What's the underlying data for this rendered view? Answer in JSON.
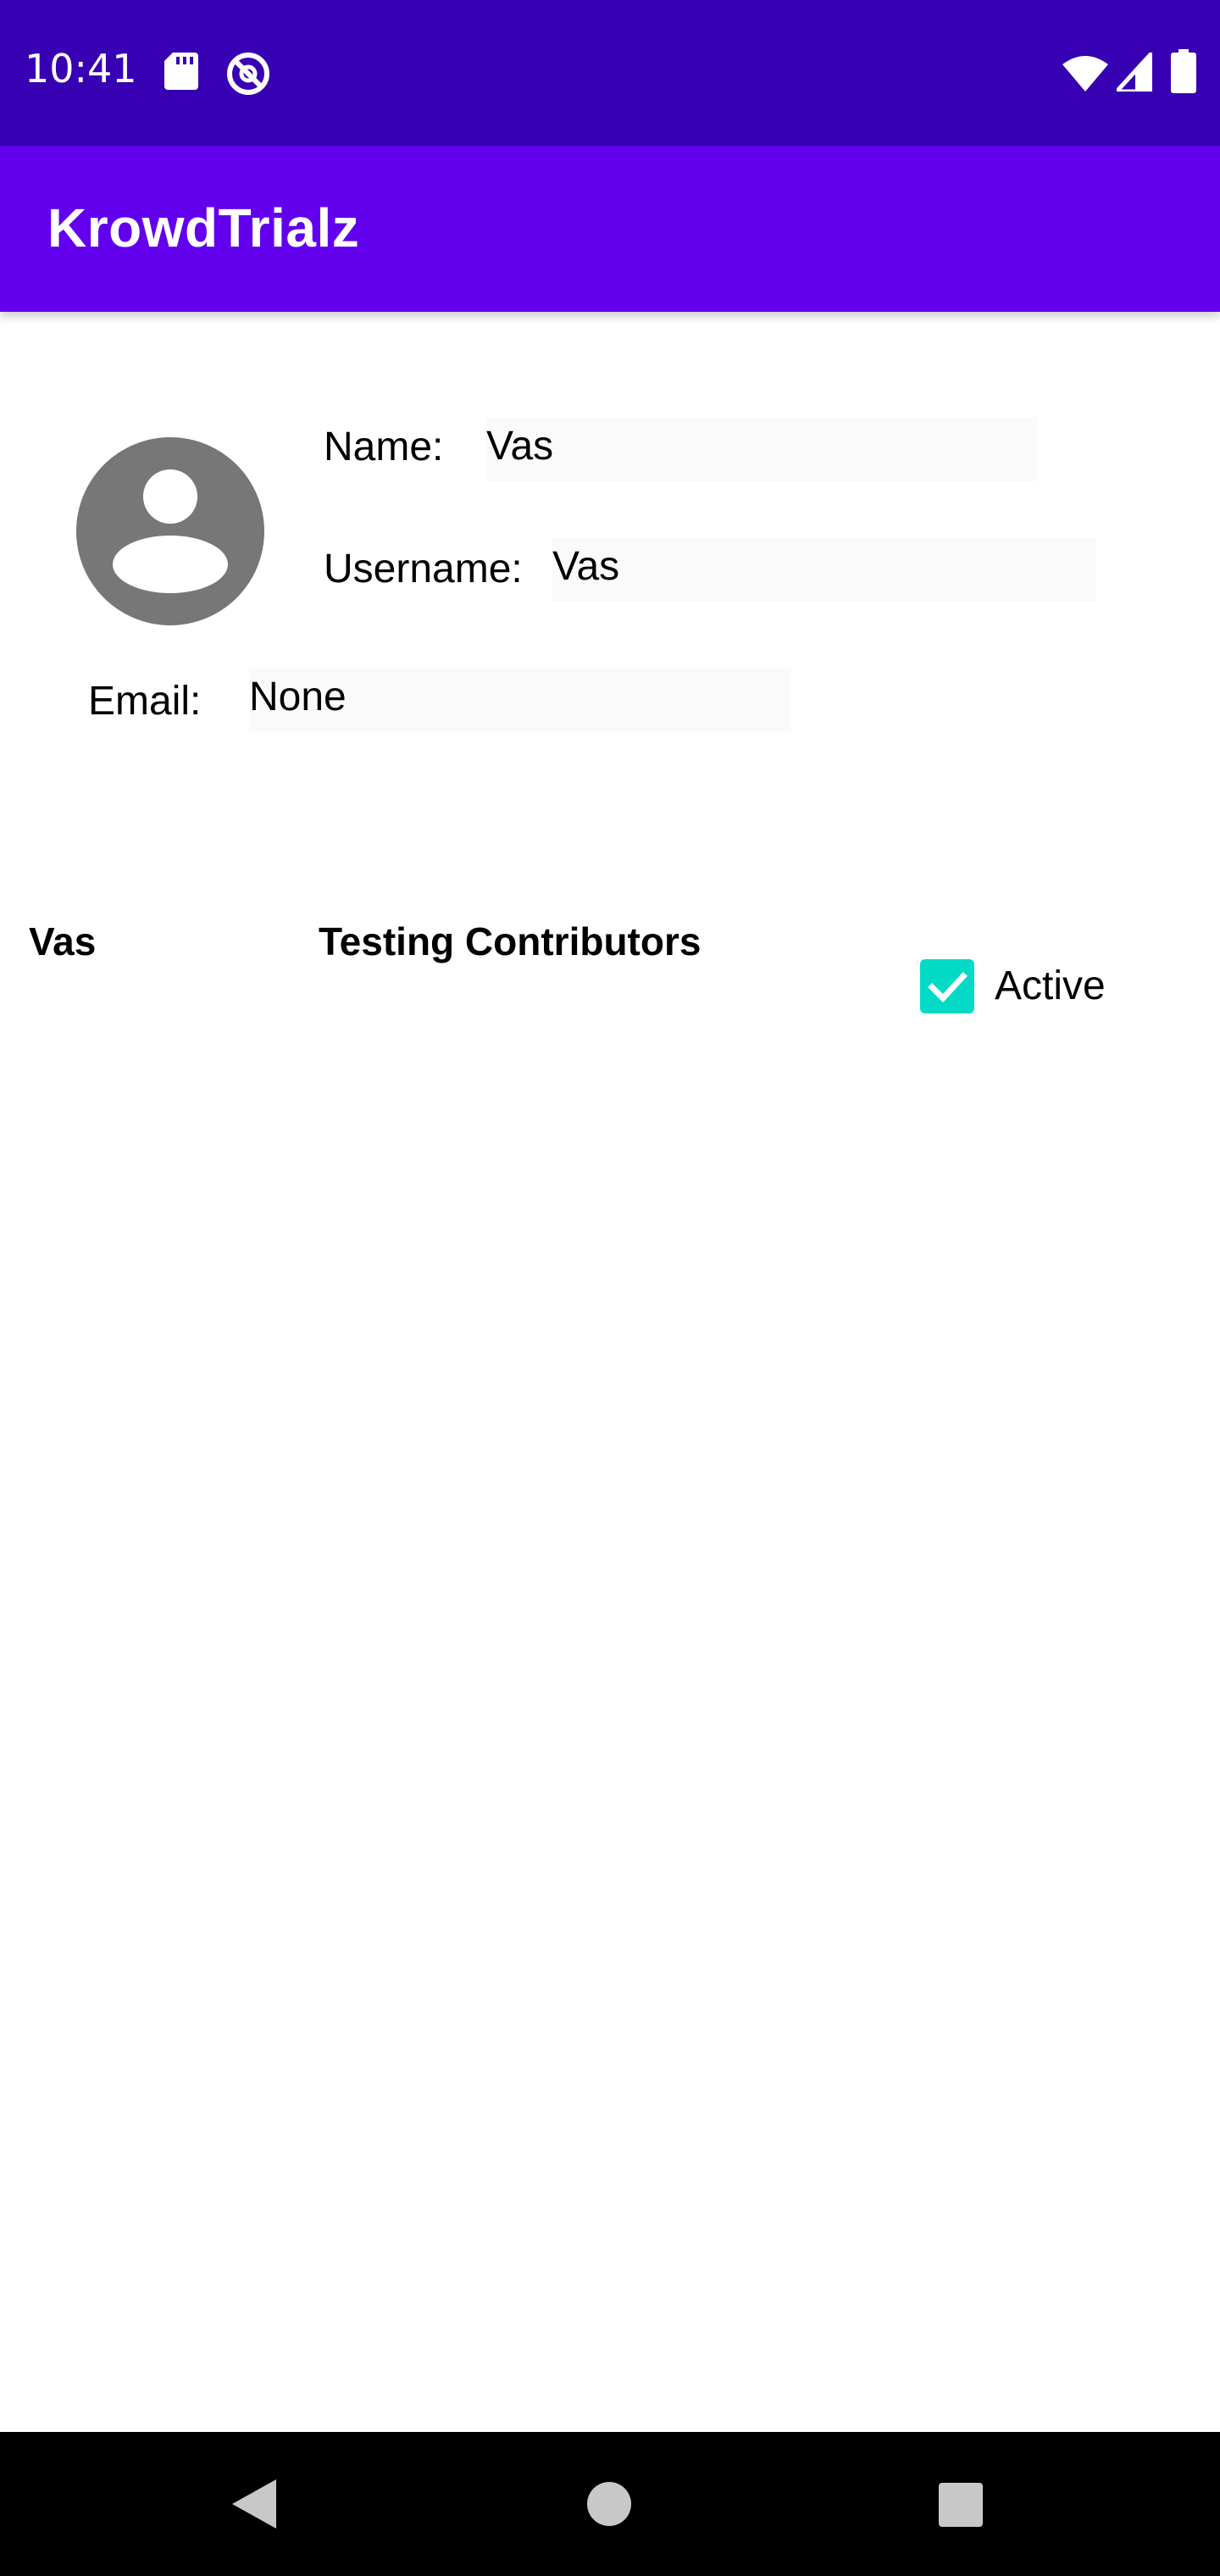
{
  "status_bar": {
    "time": "10:41",
    "icons": [
      "sd-card-icon",
      "sync-icon",
      "wifi-icon",
      "cell-signal-icon",
      "battery-icon"
    ]
  },
  "app_bar": {
    "title": "KrowdTrialz",
    "color": "#6200ee"
  },
  "profile": {
    "name_label": "Name:",
    "name_value": "Vas",
    "username_label": "Username:",
    "username_value": "Vas",
    "email_label": "Email:",
    "email_value": "None"
  },
  "experiment_row": {
    "owner": "Vas",
    "title": "Testing Contributors",
    "active_label": "Active",
    "active_checked": true,
    "accent_color": "#03dac5"
  },
  "nav_bar": {
    "icons": [
      "back-icon",
      "home-icon",
      "recents-icon"
    ]
  }
}
